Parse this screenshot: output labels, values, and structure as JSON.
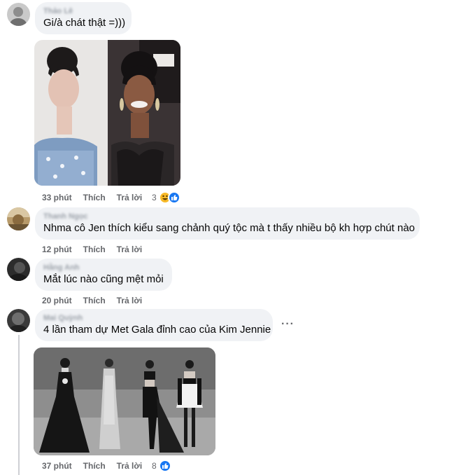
{
  "comments": [
    {
      "author": "Thảo Lê",
      "text": "Gi/à chát thật =)))",
      "time": "33 phút",
      "like": "Thích",
      "reply": "Trả lời",
      "reaction_count": "3",
      "reactions": [
        "haha",
        "like"
      ]
    },
    {
      "author": "Thanh Ngọc",
      "text": "Nhma cô Jen thích kiểu sang chảnh quý tộc mà t thấy nhiều bộ kh hợp chút nào",
      "time": "12 phút",
      "like": "Thích",
      "reply": "Trả lời"
    },
    {
      "author": "Hằng Anh",
      "text": "Mắt lúc nào cũng mệt mỏi",
      "time": "20 phút",
      "like": "Thích",
      "reply": "Trả lời"
    },
    {
      "author": "Mai Quỳnh",
      "text": "4 lần tham dự Met Gala đỉnh cao của Kim Jennie",
      "time": "37 phút",
      "like": "Thích",
      "reply": "Trả lời",
      "reaction_count": "8",
      "reactions": [
        "like"
      ],
      "more": "···"
    }
  ],
  "colors": {
    "bubble": "#f0f2f5",
    "meta": "#65676b",
    "like_blue": "#1877f2",
    "haha_yellow": "#f7b928"
  }
}
